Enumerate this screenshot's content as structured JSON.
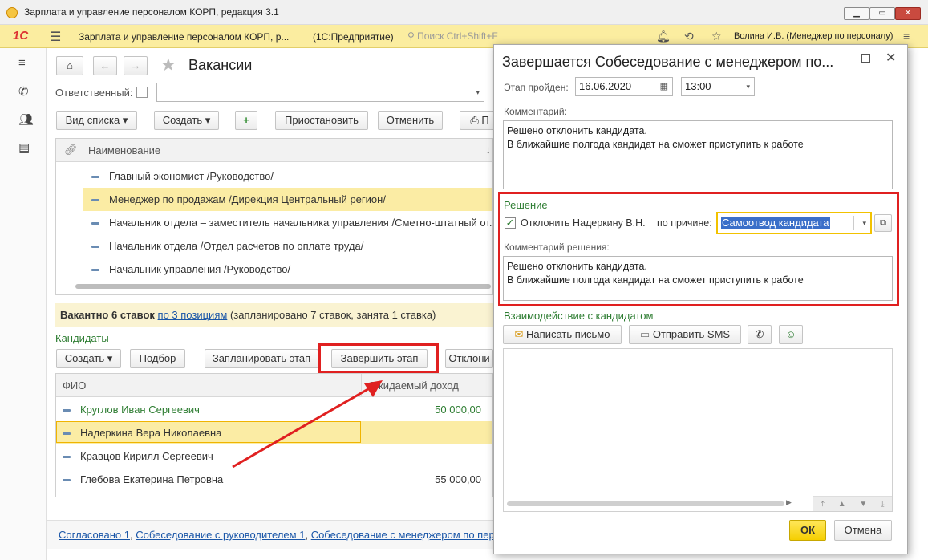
{
  "window": {
    "title": "Зарплата и управление персоналом КОРП, редакция 3.1",
    "min_label": "▁",
    "max_label": "▭",
    "close_label": "✕"
  },
  "appbar": {
    "logo": "1С",
    "app_title": "Зарплата и управление персоналом КОРП, р...",
    "app_type": "(1С:Предприятие)",
    "search_placeholder": "Поиск Ctrl+Shift+F",
    "user": "Волина И.В. (Менеджер по персоналу)"
  },
  "vacancies": {
    "title": "Вакансии",
    "responsible_label": "Ответственный:",
    "toolbar": {
      "view_list": "Вид списка",
      "create": "Создать",
      "suspend": "Приостановить",
      "cancel": "Отменить",
      "print": "П"
    },
    "column_name": "Наименование",
    "rows": [
      "Главный экономист /Руководство/",
      "Менеджер по продажам /Дирекция Центральный регион/",
      "Начальник отдела – заместитель начальника управления /Сметно-штатный от...",
      "Начальник отдела /Отдел расчетов по оплате труда/",
      "Начальник управления /Руководство/"
    ],
    "summary_bold": "Вакантно 6 ставок",
    "summary_link": "по 3 позициям",
    "summary_rest": "(запланировано 7 ставок, занята 1 ставка)"
  },
  "candidates": {
    "section_title": "Кандидаты",
    "toolbar": {
      "create": "Создать",
      "select": "Подбор",
      "plan_stage": "Запланировать этап",
      "finish_stage": "Завершить этап",
      "reject": "Отклони"
    },
    "col_name": "ФИО",
    "col_income": "Ожидаемый доход",
    "rows": [
      {
        "name": "Круглов Иван Сергеевич",
        "income": "50 000,00"
      },
      {
        "name": "Надеркина Вера Николаевна",
        "income": ""
      },
      {
        "name": "Кравцов Кирилл Сергеевич",
        "income": ""
      },
      {
        "name": "Глебова Екатерина Петровна",
        "income": "55 000,00"
      }
    ]
  },
  "footer_links": {
    "l1": "Согласовано 1",
    "l2": "Собеседование с руководителем 1",
    "l3": "Собеседование с менеджером по пер"
  },
  "dialog": {
    "title": "Завершается Собеседование с менеджером по...",
    "stage_label": "Этап пройден:",
    "date": "16.06.2020",
    "time": "13:00",
    "comment_label": "Комментарий:",
    "comment_line1": "Решено отклонить кандидата.",
    "comment_line2": "В ближайшие полгода кандидат на сможет приступить к работе",
    "decision_title": "Решение",
    "reject_label": "Отклонить Надеркину В.Н.",
    "reason_label": "по причине:",
    "reason_value": "Самоотвод кандидата",
    "decision_comment_label": "Комментарий решения:",
    "decision_comment_line1": "Решено отклонить кандидата.",
    "decision_comment_line2": "В ближайшие полгода кандидат на сможет приступить к работе",
    "interaction_title": "Взаимодействие с кандидатом",
    "write_letter": "Написать письмо",
    "send_sms": "Отправить SMS",
    "ok": "ОК",
    "cancel": "Отмена"
  },
  "colors": {
    "accent_yellow": "#fbeda0",
    "highlight": "#fbeca4",
    "annotation_red": "#e02020",
    "section_green": "#2e7d32",
    "link_blue": "#1a56a8"
  }
}
